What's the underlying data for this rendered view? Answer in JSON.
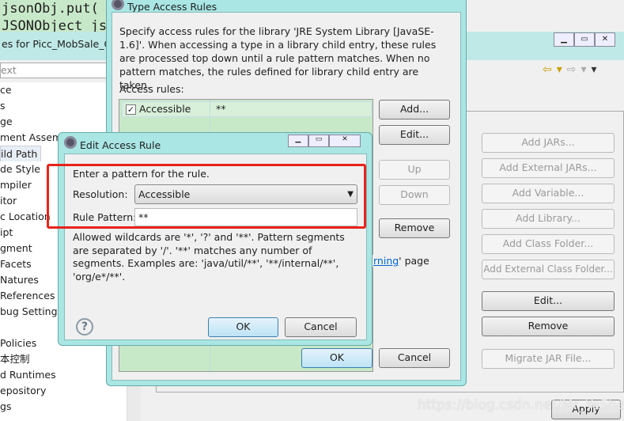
{
  "editor": {
    "lines": [
      "jsonObj.put( c",
      "JSONObject jso"
    ]
  },
  "properties": {
    "title": "es for Picc_MobSale_Co",
    "filter_placeholder": "ext",
    "tree": [
      "ce",
      "s",
      "ge",
      "ment Assemb",
      "ild Path",
      "de Style",
      "mpiler",
      "itor",
      "c Location",
      "ipt",
      "gment",
      "Facets",
      "Natures",
      "References",
      "bug Settings",
      "",
      "Policies",
      "本控制",
      "d Runtimes",
      "epository",
      "gs"
    ],
    "selected_index": 4,
    "buttons": {
      "add_jars": "Add JARs...",
      "add_external_jars": "Add External JARs...",
      "add_variable": "Add Variable...",
      "add_library": "Add Library...",
      "add_class_folder": "Add Class Folder...",
      "add_external_class_folder": "Add External Class Folder...",
      "edit": "Edit...",
      "remove": "Remove",
      "migrate": "Migrate JAR File..."
    },
    "apply": "Apply",
    "watermark": "https://blog.csdn.net/Mr_YeShenFei"
  },
  "type_access_rules": {
    "title": "Type Access Rules",
    "description": "Specify access rules for the library 'JRE System Library [JavaSE-1.6]'. When accessing a type in a library child entry, these rules are processed top down until a rule pattern matches. When no pattern matches, the rules defined for library child entry are taken.",
    "rules_label": "Access rules:",
    "rules": [
      {
        "checked": true,
        "kind": "Accessible",
        "pattern": "**"
      }
    ],
    "buttons": {
      "add": "Add...",
      "edit": "Edit...",
      "up": "Up",
      "down": "Down",
      "remove": "Remove",
      "ok": "OK",
      "cancel": "Cancel"
    },
    "link_fragment": "rning",
    "link_suffix": "' page"
  },
  "edit_access_rule": {
    "title": "Edit Access Rule",
    "instruction": "Enter a pattern for the rule.",
    "resolution_label": "Resolution:",
    "resolution_value": "Accessible",
    "pattern_label": "Rule Pattern:",
    "pattern_value": "**",
    "help_text": "Allowed wildcards are '*', '?' and '**'. Pattern segments are separated by '/'. '**' matches any number of segments. Examples are: 'java/util/**', '**/internal/**', 'org/e*/**'.",
    "ok": "OK",
    "cancel": "Cancel"
  },
  "colors": {
    "highlight": "#e8231b",
    "link": "#0066cc"
  }
}
